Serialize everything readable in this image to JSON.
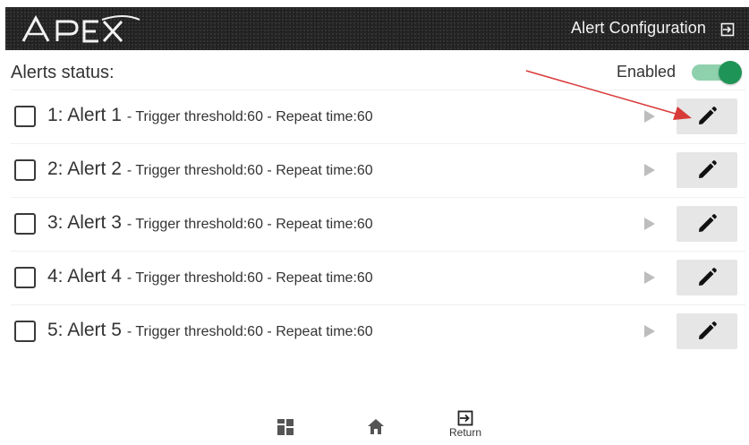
{
  "header": {
    "logo_text": "APEX",
    "title": "Alert Configuration",
    "exit_icon": "exit-icon"
  },
  "status": {
    "label": "Alerts status:",
    "enabled_label": "Enabled",
    "enabled": true,
    "toggle_color": "#1e9456"
  },
  "alerts": [
    {
      "name": "1: Alert 1",
      "detail": "- Trigger threshold:60 - Repeat time:60"
    },
    {
      "name": "2: Alert 2",
      "detail": "- Trigger threshold:60 - Repeat time:60"
    },
    {
      "name": "3: Alert 3",
      "detail": "- Trigger threshold:60 - Repeat time:60"
    },
    {
      "name": "4: Alert 4",
      "detail": "- Trigger threshold:60 - Repeat time:60"
    },
    {
      "name": "5: Alert 5",
      "detail": "- Trigger threshold:60 - Repeat time:60"
    }
  ],
  "bottom_nav": {
    "return_label": "Return"
  },
  "annotation_color": "#d83a3a"
}
